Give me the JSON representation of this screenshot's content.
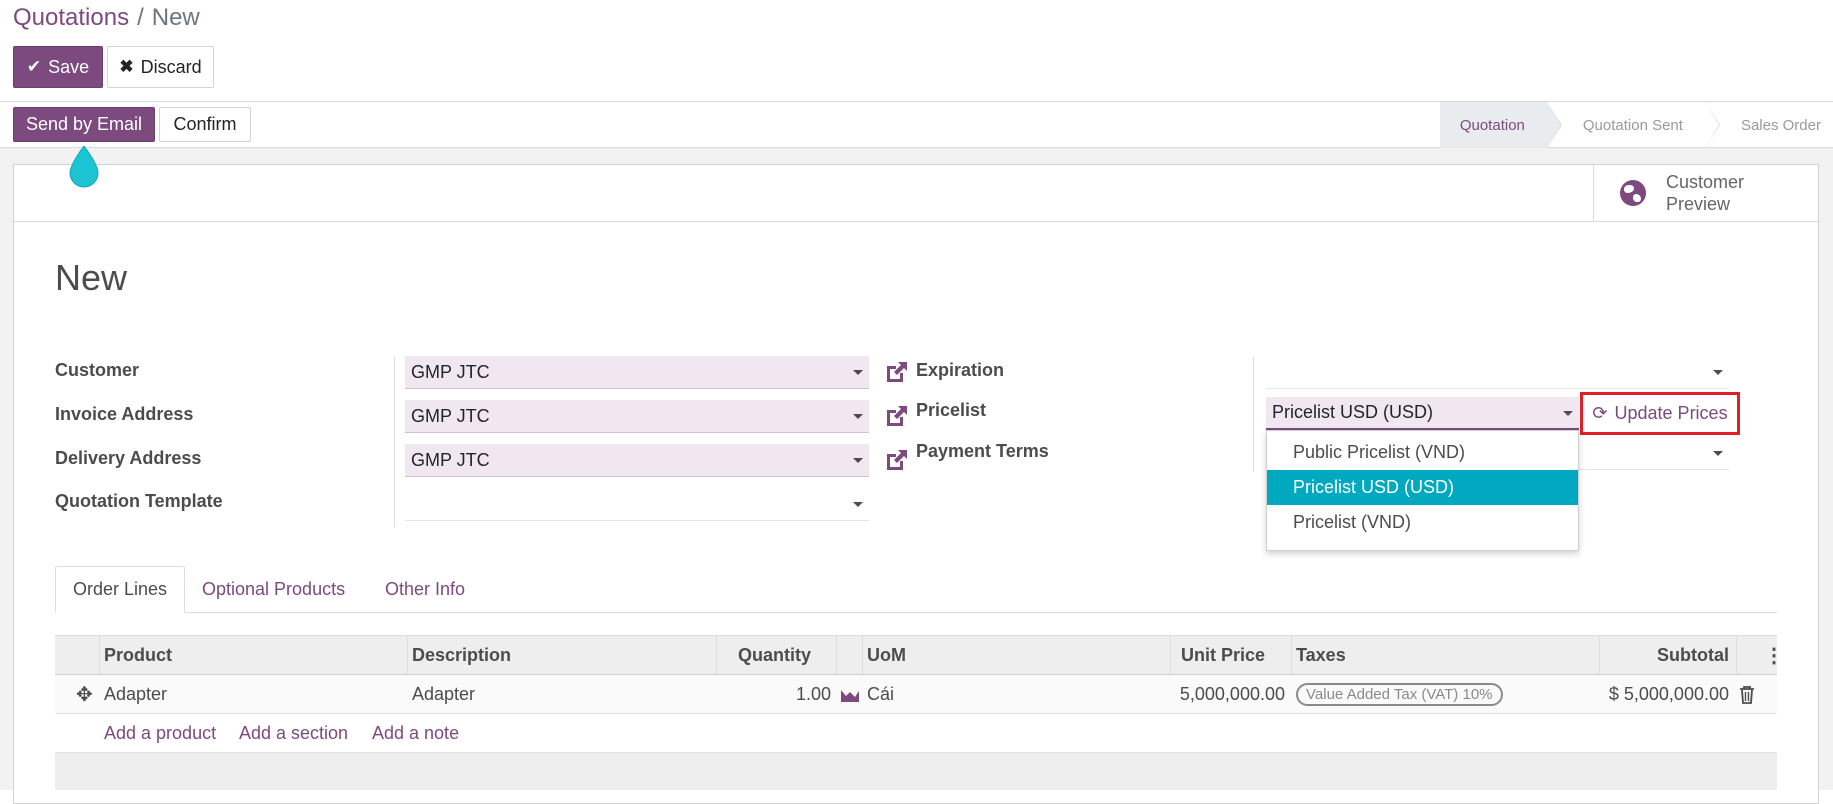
{
  "breadcrumb": {
    "parent": "Quotations",
    "separator": "/",
    "current": "New"
  },
  "control": {
    "save_label": "Save",
    "discard_label": "Discard"
  },
  "actions": {
    "send_email_label": "Send by Email",
    "confirm_label": "Confirm"
  },
  "status_steps": [
    {
      "label": "Quotation",
      "active": true
    },
    {
      "label": "Quotation Sent",
      "active": false
    },
    {
      "label": "Sales Order",
      "active": false
    }
  ],
  "button_box": {
    "customer_preview_line1": "Customer",
    "customer_preview_line2": "Preview"
  },
  "record": {
    "title": "New"
  },
  "fields": {
    "customer": {
      "label": "Customer",
      "value": "GMP JTC"
    },
    "invoice_address": {
      "label": "Invoice Address",
      "value": "GMP JTC"
    },
    "delivery_address": {
      "label": "Delivery Address",
      "value": "GMP JTC"
    },
    "quotation_template": {
      "label": "Quotation Template",
      "value": ""
    },
    "expiration": {
      "label": "Expiration",
      "value": ""
    },
    "pricelist": {
      "label": "Pricelist",
      "value": "Pricelist USD (USD)"
    },
    "payment_terms": {
      "label": "Payment Terms",
      "value": ""
    }
  },
  "pricelist_dropdown": {
    "options": [
      "Public Pricelist (VND)",
      "Pricelist USD (USD)",
      "Pricelist (VND)"
    ],
    "selected_index": 1
  },
  "update_prices_label": "Update Prices",
  "tabs": [
    {
      "label": "Order Lines",
      "active": true
    },
    {
      "label": "Optional Products",
      "active": false
    },
    {
      "label": "Other Info",
      "active": false
    }
  ],
  "order_table": {
    "columns": [
      "Product",
      "Description",
      "Quantity",
      "UoM",
      "Unit Price",
      "Taxes",
      "Subtotal"
    ],
    "rows": [
      {
        "product": "Adapter",
        "description": "Adapter",
        "quantity": "1.00",
        "uom": "Cái",
        "unit_price": "5,000,000.00",
        "taxes": "Value Added Tax (VAT) 10%",
        "subtotal": "$ 5,000,000.00"
      }
    ],
    "add_product": "Add a product",
    "add_section": "Add a section",
    "add_note": "Add a note"
  },
  "colors": {
    "brand": "#7c4a7f",
    "highlight": "#00a9bf",
    "annotation": "#e01f26"
  }
}
